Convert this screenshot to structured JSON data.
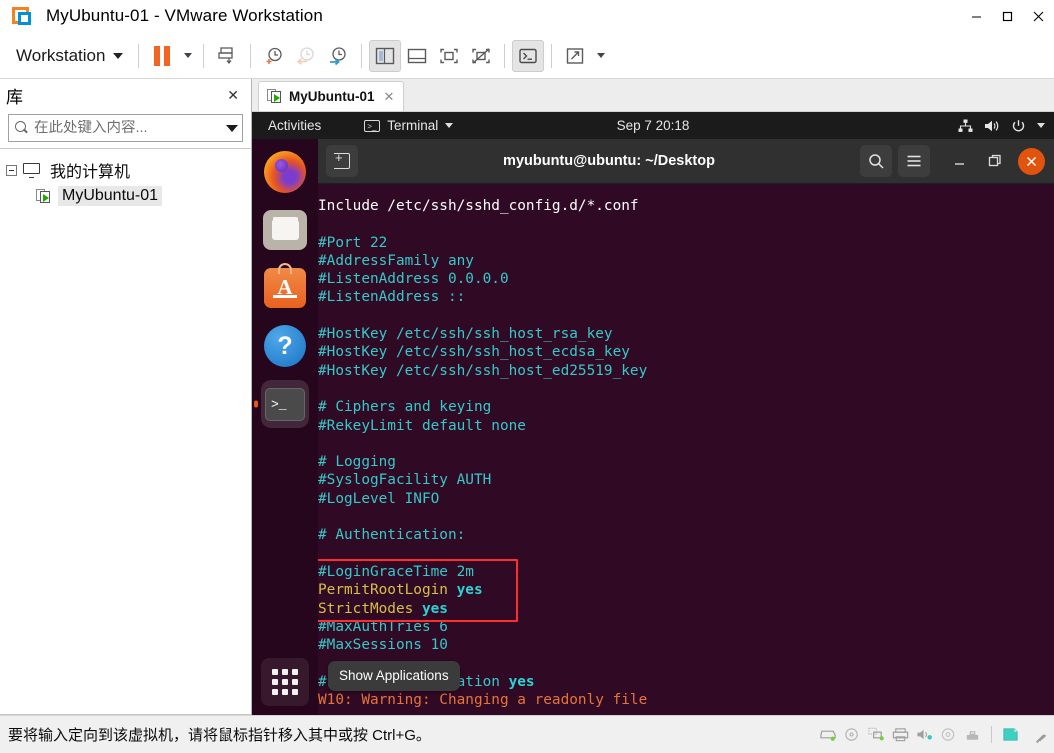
{
  "window": {
    "title": "MyUbuntu-01 - VMware Workstation",
    "logo_icon": "vmware-logo-icon",
    "minimize_label": "—",
    "maximize_label": "□",
    "close_label": "✕"
  },
  "toolbar": {
    "workstation_menu": "Workstation",
    "buttons": [
      {
        "name": "suspend-button",
        "icon": "pause-icon"
      },
      {
        "name": "power-dropdown",
        "icon": "chevron-down-icon"
      },
      {
        "name": "manage-snapshot-button",
        "icon": "snapshot-save-icon"
      },
      {
        "name": "take-snapshot-button",
        "icon": "clock-plus-icon"
      },
      {
        "name": "revert-snapshot-button",
        "icon": "clock-back-icon"
      },
      {
        "name": "snapshot-manager-button",
        "icon": "clock-wrench-icon"
      },
      {
        "name": "show-library-button",
        "icon": "sidebar-panel-icon"
      },
      {
        "name": "show-console-view-button",
        "icon": "bottom-panel-icon"
      },
      {
        "name": "show-thumbnails-button",
        "icon": "center-frame-icon"
      },
      {
        "name": "hide-thumbnails-button",
        "icon": "crossed-frame-icon"
      },
      {
        "name": "show-terminal-button",
        "icon": "terminal-prompt-icon"
      },
      {
        "name": "fullscreen-button",
        "icon": "expand-arrows-icon"
      },
      {
        "name": "fullscreen-dropdown",
        "icon": "chevron-down-icon"
      }
    ]
  },
  "library": {
    "title": "库",
    "close_label": "✕",
    "search_placeholder": "在此处键入内容...",
    "search_value": "",
    "tree": [
      {
        "label": "我的计算机",
        "level": 0,
        "selected": false,
        "icon": "monitor-icon"
      },
      {
        "label": "MyUbuntu-01",
        "level": 1,
        "selected": true,
        "icon": "vm-icon"
      }
    ]
  },
  "vm_tab": {
    "label": "MyUbuntu-01",
    "close_label": "✕",
    "icon": "vm-icon"
  },
  "guest": {
    "topbar": {
      "activities": "Activities",
      "app_name": "Terminal",
      "app_icon": "terminal-icon",
      "clock": "Sep 7  20:18",
      "indicators": [
        "network-icon",
        "volume-icon",
        "power-icon",
        "chevron-down-icon"
      ]
    },
    "dock": [
      {
        "name": "dock-firefox",
        "label": "Firefox",
        "active": false
      },
      {
        "name": "dock-files",
        "label": "Files",
        "active": false
      },
      {
        "name": "dock-software",
        "label": "Ubuntu Software",
        "active": false
      },
      {
        "name": "dock-help",
        "label": "Help",
        "active": false
      },
      {
        "name": "dock-terminal",
        "label": "Terminal",
        "active": true
      }
    ],
    "show_applications_label": "Show Applications",
    "tooltip": "Show Applications",
    "terminal": {
      "title": "myubuntu@ubuntu: ~/Desktop",
      "new_tab_icon": "new-tab-icon",
      "search_icon": "search-icon",
      "menu_icon": "hamburger-menu-icon",
      "minimize_label": "—",
      "maximize_label": "❐",
      "close_label": "✕",
      "lines": [
        {
          "segments": [
            {
              "t": "Include /etc/ssh/sshd_config.d/*.conf",
              "c": "plain"
            }
          ]
        },
        {
          "segments": [
            {
              "t": "",
              "c": "plain"
            }
          ]
        },
        {
          "segments": [
            {
              "t": "#Port 22",
              "c": "cmt"
            }
          ]
        },
        {
          "segments": [
            {
              "t": "#AddressFamily any",
              "c": "cmt"
            }
          ]
        },
        {
          "segments": [
            {
              "t": "#ListenAddress 0.0.0.0",
              "c": "cmt"
            }
          ]
        },
        {
          "segments": [
            {
              "t": "#ListenAddress ::",
              "c": "cmt"
            }
          ]
        },
        {
          "segments": [
            {
              "t": "",
              "c": "plain"
            }
          ]
        },
        {
          "segments": [
            {
              "t": "#HostKey /etc/ssh/ssh_host_rsa_key",
              "c": "cmt"
            }
          ]
        },
        {
          "segments": [
            {
              "t": "#HostKey /etc/ssh/ssh_host_ecdsa_key",
              "c": "cmt"
            }
          ]
        },
        {
          "segments": [
            {
              "t": "#HostKey /etc/ssh/ssh_host_ed25519_key",
              "c": "cmt"
            }
          ]
        },
        {
          "segments": [
            {
              "t": "",
              "c": "plain"
            }
          ]
        },
        {
          "segments": [
            {
              "t": "# Ciphers and keying",
              "c": "cmt"
            }
          ]
        },
        {
          "segments": [
            {
              "t": "#RekeyLimit default none",
              "c": "cmt"
            }
          ]
        },
        {
          "segments": [
            {
              "t": "",
              "c": "plain"
            }
          ]
        },
        {
          "segments": [
            {
              "t": "# Logging",
              "c": "cmt"
            }
          ]
        },
        {
          "segments": [
            {
              "t": "#SyslogFacility AUTH",
              "c": "cmt"
            }
          ]
        },
        {
          "segments": [
            {
              "t": "#LogLevel INFO",
              "c": "cmt"
            }
          ]
        },
        {
          "segments": [
            {
              "t": "",
              "c": "plain"
            }
          ]
        },
        {
          "segments": [
            {
              "t": "# Authentication:",
              "c": "cmt"
            }
          ]
        },
        {
          "segments": [
            {
              "t": "",
              "c": "plain"
            }
          ]
        },
        {
          "segments": [
            {
              "t": "#LoginGraceTime 2m",
              "c": "cmt"
            }
          ]
        },
        {
          "segments": [
            {
              "t": "PermitRootLogin ",
              "c": "key"
            },
            {
              "t": "yes",
              "c": "val"
            }
          ]
        },
        {
          "segments": [
            {
              "t": "StrictModes ",
              "c": "key"
            },
            {
              "t": "yes",
              "c": "val"
            }
          ]
        },
        {
          "segments": [
            {
              "t": "#MaxAuthTries 6",
              "c": "cmt"
            }
          ]
        },
        {
          "segments": [
            {
              "t": "#MaxSessions 10",
              "c": "cmt"
            }
          ]
        },
        {
          "segments": [
            {
              "t": "",
              "c": "plain"
            }
          ]
        },
        {
          "segments": [
            {
              "t": "#PubkeyAuthentication ",
              "c": "cmt"
            },
            {
              "t": "yes",
              "c": "val"
            }
          ]
        },
        {
          "segments": [
            {
              "t": "W10: Warning: Changing a readonly file",
              "c": "warn"
            }
          ]
        }
      ]
    }
  },
  "statusbar": {
    "message": "要将输入定向到该虚拟机，请将鼠标指针移入其中或按 Ctrl+G。",
    "devices": [
      {
        "name": "hard-disk-icon"
      },
      {
        "name": "cd-dvd-icon"
      },
      {
        "name": "network-adapter-icon"
      },
      {
        "name": "printer-icon"
      },
      {
        "name": "sound-card-icon"
      },
      {
        "name": "floppy-icon"
      },
      {
        "name": "usb-icon"
      },
      {
        "name": "display-icon"
      }
    ]
  }
}
